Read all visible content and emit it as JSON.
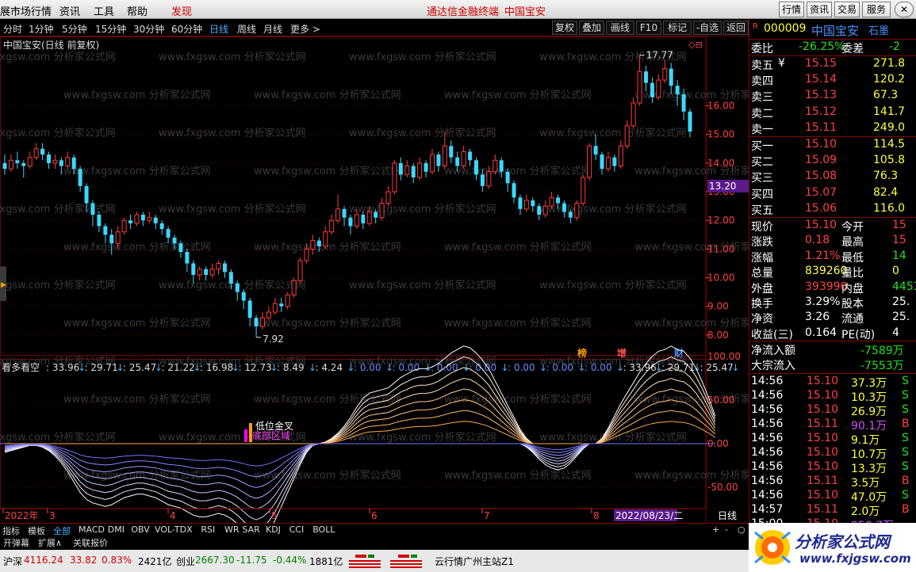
{
  "menubar": {
    "items": [
      "展市场行情",
      "资讯",
      "工具",
      "帮助"
    ],
    "discover": "发现",
    "title": "通达信金融终端",
    "stock_name": "中国宝安",
    "right_buttons": [
      "行情",
      "资讯",
      "交易",
      "服务"
    ]
  },
  "periods": {
    "items": [
      "分时",
      "1分钟",
      "5分钟",
      "15分钟",
      "30分钟",
      "60分钟",
      "日线",
      "周线",
      "月线",
      "更多 >"
    ],
    "active": "日线"
  },
  "tools": [
    "复权",
    "叠加",
    "画线",
    "F10",
    "标记",
    "-自选",
    "返回"
  ],
  "chart_title": "中国宝安(日线 前复权)",
  "price_axis": [
    {
      "v": 16.0,
      "t": "16.00"
    },
    {
      "v": 15.0,
      "t": "15.00"
    },
    {
      "v": 14.0,
      "t": "14.00"
    },
    {
      "v": 13.0,
      "t": "13.00"
    },
    {
      "v": 12.0,
      "t": "12.00"
    },
    {
      "v": 11.0,
      "t": "11.00"
    },
    {
      "v": 10.0,
      "t": "10.00"
    },
    {
      "v": 9.0,
      "t": "9.00"
    },
    {
      "v": 8.0,
      "t": "8.00"
    }
  ],
  "current_price_label": "13.20",
  "high_label": "17.77",
  "low_label": "7.92",
  "markers": [
    "榜",
    "增",
    "财"
  ],
  "indicator": {
    "name": "看多看空",
    "values": [
      "33.96",
      "29.71",
      "25.47",
      "21.22",
      "16.98",
      "12.73",
      "8.49",
      "4.24",
      "0.00",
      "0.00",
      "0.00",
      "0.00",
      "0.00",
      "0.00",
      "0.00",
      "33.96",
      "29.71",
      "25.47"
    ],
    "axis": [
      {
        "v": 100,
        "t": "100.00"
      },
      {
        "v": 50,
        "t": "50.00"
      },
      {
        "v": 0,
        "t": "0.00"
      },
      {
        "v": -50,
        "t": "-50.00"
      }
    ],
    "annotation1": "低位金叉",
    "annotation2": "底部区域"
  },
  "date_axis": {
    "labels": [
      "2022年",
      "3",
      "4",
      "5",
      "6",
      "7",
      "8"
    ],
    "cursor_date": "2022/08/23/二",
    "period": "日线"
  },
  "bottom_tabs": [
    "指标",
    "模板",
    "全部",
    "MACD",
    "DMI",
    "OBV",
    "VOL-TDX",
    "RSI",
    "WR",
    "SAR",
    "KDJ",
    "CCI",
    "BOLL"
  ],
  "bottom_active": "全部",
  "bottom_tabs2": [
    "开弹幕",
    "扩展∧",
    "关联报价"
  ],
  "status": {
    "sh_label": "沪深",
    "sh_index": "4116.24",
    "sh_chg": "33.82",
    "sh_pct": "0.83%",
    "sh_amt": "2421亿",
    "cy_label": "创业",
    "cy_index": "2667.30",
    "cy_chg": "-11.75",
    "cy_pct": "-0.44%",
    "cy_amt": "1881亿",
    "server": "云行情广州主站Z1"
  },
  "quote": {
    "code": "000009",
    "name": "中国宝安",
    "tag": "石墨",
    "prefix": "R",
    "weibi_label": "委比",
    "weibi": "-26.25%",
    "weicha_label": "委差",
    "weicha": "-2",
    "asks": [
      {
        "l": "卖五",
        "p": "15.15",
        "v": "271.8",
        "m": "¥"
      },
      {
        "l": "卖四",
        "p": "15.14",
        "v": "120.2"
      },
      {
        "l": "卖三",
        "p": "15.13",
        "v": "67.3"
      },
      {
        "l": "卖二",
        "p": "15.12",
        "v": "141.7"
      },
      {
        "l": "卖一",
        "p": "15.11",
        "v": "249.0"
      }
    ],
    "bids": [
      {
        "l": "买一",
        "p": "15.10",
        "v": "114.5"
      },
      {
        "l": "买二",
        "p": "15.09",
        "v": "105.8"
      },
      {
        "l": "买三",
        "p": "15.08",
        "v": "76.3"
      },
      {
        "l": "买四",
        "p": "15.07",
        "v": "82.4"
      },
      {
        "l": "买五",
        "p": "15.06",
        "v": "116.0"
      }
    ],
    "stats": [
      {
        "l1": "现价",
        "v1": "15.10",
        "c1": "red",
        "l2": "今开",
        "v2": "15",
        "c2": "red"
      },
      {
        "l1": "涨跌",
        "v1": "0.18",
        "c1": "red",
        "l2": "最高",
        "v2": "15",
        "c2": "red"
      },
      {
        "l1": "涨幅",
        "v1": "1.21%",
        "c1": "red",
        "l2": "最低",
        "v2": "14",
        "c2": "grn"
      },
      {
        "l1": "总量",
        "v1": "839260",
        "c1": "yel",
        "l2": "量比",
        "v2": "0",
        "c2": "yel"
      },
      {
        "l1": "外盘",
        "v1": "393990",
        "c1": "red",
        "l2": "内盘",
        "v2": "4453",
        "c2": "grn"
      },
      {
        "l1": "换手",
        "v1": "3.29%",
        "c1": "wht",
        "l2": "股本",
        "v2": "25.",
        "c2": "wht"
      },
      {
        "l1": "净资",
        "v1": "3.26",
        "c1": "wht",
        "l2": "流通",
        "v2": "25.",
        "c2": "wht"
      },
      {
        "l1": "收益(三)",
        "v1": "0.164",
        "c1": "wht",
        "l2": "PE(动)",
        "v2": "4",
        "c2": "wht"
      }
    ],
    "flows": [
      {
        "l": "净流入额",
        "v": "-7589万"
      },
      {
        "l": "大宗流入",
        "v": "-7553万"
      }
    ],
    "ticks": [
      {
        "t": "14:56",
        "p": "15.10",
        "v": "37.3万",
        "s": "S"
      },
      {
        "t": "14:56",
        "p": "15.10",
        "v": "10.3万",
        "s": "S"
      },
      {
        "t": "14:56",
        "p": "15.10",
        "v": "26.9万",
        "s": "S"
      },
      {
        "t": "14:56",
        "p": "15.11",
        "v": "90.1万",
        "s": "B"
      },
      {
        "t": "14:56",
        "p": "15.10",
        "v": "9.1万",
        "s": "S"
      },
      {
        "t": "14:56",
        "p": "15.10",
        "v": "10.7万",
        "s": "S"
      },
      {
        "t": "14:56",
        "p": "15.10",
        "v": "13.3万",
        "s": "S"
      },
      {
        "t": "14:56",
        "p": "15.11",
        "v": "3.5万",
        "s": "B"
      },
      {
        "t": "14:56",
        "p": "15.10",
        "v": "47.0万",
        "s": "S"
      },
      {
        "t": "14:57",
        "p": "15.11",
        "v": "2.0万",
        "s": "B"
      },
      {
        "t": "15:00",
        "p": "15.10",
        "v": "950.7万",
        "s": ""
      }
    ]
  },
  "watermark": "www.fxgsw.com 分析家公式网",
  "logo": {
    "name": "分析家公式网",
    "url": "www.fxjgsw.com"
  },
  "colors": {
    "up": "#ff3c3c",
    "down": "#3cd8ff",
    "bg": "#000000",
    "grid": "#700000"
  },
  "chart_data": {
    "type": "candlestick",
    "ylim": [
      7.5,
      18.2
    ],
    "candles": [
      [
        14.0,
        13.8,
        14.3,
        13.6
      ],
      [
        13.8,
        14.1,
        14.3,
        13.7
      ],
      [
        14.1,
        14.0,
        14.4,
        13.8
      ],
      [
        14.0,
        13.9,
        14.1,
        13.5
      ],
      [
        13.9,
        14.2,
        14.4,
        13.8
      ],
      [
        14.2,
        14.5,
        14.7,
        14.1
      ],
      [
        14.5,
        14.3,
        14.7,
        14.1
      ],
      [
        14.3,
        14.0,
        14.4,
        13.8
      ],
      [
        14.0,
        14.1,
        14.3,
        13.8
      ],
      [
        14.1,
        13.9,
        14.2,
        13.6
      ],
      [
        13.9,
        14.2,
        14.4,
        13.8
      ],
      [
        14.2,
        13.8,
        14.3,
        13.6
      ],
      [
        13.8,
        13.2,
        13.9,
        13.0
      ],
      [
        13.2,
        12.6,
        13.3,
        12.3
      ],
      [
        12.6,
        12.2,
        12.7,
        11.8
      ],
      [
        12.2,
        11.8,
        12.3,
        11.6
      ],
      [
        11.8,
        11.5,
        11.9,
        11.2
      ],
      [
        11.5,
        11.2,
        11.7,
        10.8
      ],
      [
        11.2,
        11.6,
        11.8,
        11.0
      ],
      [
        11.6,
        12.0,
        12.1,
        11.5
      ],
      [
        12.0,
        11.9,
        12.2,
        11.7
      ],
      [
        11.9,
        12.2,
        12.3,
        11.8
      ],
      [
        12.2,
        12.0,
        12.3,
        11.8
      ],
      [
        12.0,
        12.1,
        12.3,
        11.9
      ],
      [
        12.1,
        11.9,
        12.2,
        11.7
      ],
      [
        11.9,
        11.7,
        12.0,
        11.5
      ],
      [
        11.7,
        11.4,
        11.8,
        11.2
      ],
      [
        11.4,
        11.2,
        11.5,
        11.0
      ],
      [
        11.2,
        10.9,
        11.3,
        10.7
      ],
      [
        10.9,
        10.5,
        11.0,
        10.2
      ],
      [
        10.5,
        10.1,
        10.6,
        9.8
      ],
      [
        10.1,
        10.3,
        10.4,
        9.9
      ],
      [
        10.3,
        10.1,
        10.4,
        9.9
      ],
      [
        10.1,
        10.3,
        10.5,
        10.0
      ],
      [
        10.3,
        10.5,
        10.6,
        10.1
      ],
      [
        10.5,
        10.2,
        10.6,
        10.0
      ],
      [
        10.2,
        9.8,
        10.3,
        9.6
      ],
      [
        9.8,
        9.5,
        9.9,
        9.2
      ],
      [
        9.5,
        9.2,
        9.6,
        8.9
      ],
      [
        9.2,
        8.6,
        9.3,
        8.3
      ],
      [
        8.6,
        8.3,
        8.7,
        7.92
      ],
      [
        8.3,
        8.6,
        8.8,
        8.2
      ],
      [
        8.6,
        8.8,
        9.0,
        8.5
      ],
      [
        8.8,
        9.1,
        9.3,
        8.7
      ],
      [
        9.1,
        9.0,
        9.3,
        8.8
      ],
      [
        9.0,
        9.4,
        9.5,
        8.9
      ],
      [
        9.4,
        9.9,
        10.0,
        9.3
      ],
      [
        9.9,
        10.6,
        10.7,
        9.8
      ],
      [
        10.6,
        11.0,
        11.2,
        10.5
      ],
      [
        11.0,
        11.3,
        11.5,
        10.8
      ],
      [
        11.3,
        11.1,
        11.4,
        10.9
      ],
      [
        11.1,
        11.6,
        11.8,
        11.0
      ],
      [
        11.6,
        12.0,
        12.2,
        11.5
      ],
      [
        12.0,
        12.4,
        12.9,
        11.9
      ],
      [
        12.4,
        12.1,
        12.5,
        11.8
      ],
      [
        12.1,
        11.8,
        12.2,
        11.5
      ],
      [
        11.8,
        12.2,
        12.4,
        11.7
      ],
      [
        12.2,
        11.9,
        12.3,
        11.7
      ],
      [
        11.9,
        12.3,
        12.5,
        11.8
      ],
      [
        12.3,
        12.1,
        12.4,
        11.9
      ],
      [
        12.1,
        12.6,
        12.8,
        12.0
      ],
      [
        12.6,
        13.0,
        13.2,
        12.5
      ],
      [
        13.0,
        14.0,
        14.1,
        12.9
      ],
      [
        14.0,
        13.6,
        14.2,
        13.4
      ],
      [
        13.6,
        13.9,
        14.1,
        13.5
      ],
      [
        13.9,
        13.5,
        14.0,
        13.3
      ],
      [
        13.5,
        14.0,
        14.2,
        13.4
      ],
      [
        14.0,
        13.7,
        14.1,
        13.5
      ],
      [
        13.7,
        14.3,
        14.5,
        13.6
      ],
      [
        14.3,
        13.9,
        14.4,
        13.7
      ],
      [
        13.9,
        14.6,
        15.1,
        13.8
      ],
      [
        14.6,
        14.2,
        14.8,
        14.0
      ],
      [
        14.2,
        13.9,
        14.4,
        13.7
      ],
      [
        13.9,
        14.4,
        14.6,
        13.8
      ],
      [
        14.4,
        14.1,
        14.5,
        13.9
      ],
      [
        14.1,
        13.6,
        14.2,
        13.4
      ],
      [
        13.6,
        13.2,
        13.8,
        13.0
      ],
      [
        13.2,
        13.7,
        13.9,
        13.1
      ],
      [
        13.7,
        14.1,
        14.3,
        13.6
      ],
      [
        14.1,
        13.7,
        14.2,
        13.5
      ],
      [
        13.7,
        13.3,
        13.8,
        13.0
      ],
      [
        13.3,
        12.8,
        13.4,
        12.6
      ],
      [
        12.8,
        12.4,
        12.9,
        12.2
      ],
      [
        12.4,
        12.7,
        12.9,
        12.3
      ],
      [
        12.7,
        12.5,
        12.8,
        12.3
      ],
      [
        12.5,
        12.2,
        12.6,
        12.0
      ],
      [
        12.2,
        12.5,
        12.7,
        12.1
      ],
      [
        12.5,
        12.8,
        13.0,
        12.4
      ],
      [
        12.8,
        12.6,
        12.9,
        12.4
      ],
      [
        12.6,
        12.3,
        12.7,
        12.1
      ],
      [
        12.3,
        12.1,
        12.4,
        11.9
      ],
      [
        12.1,
        12.6,
        12.7,
        12.0
      ],
      [
        12.6,
        13.5,
        13.6,
        12.5
      ],
      [
        13.5,
        14.6,
        14.7,
        13.4
      ],
      [
        14.6,
        14.3,
        15.0,
        14.1
      ],
      [
        14.3,
        13.8,
        14.4,
        13.6
      ],
      [
        13.8,
        14.2,
        14.4,
        13.7
      ],
      [
        14.2,
        13.9,
        14.3,
        13.7
      ],
      [
        13.9,
        14.6,
        14.8,
        13.8
      ],
      [
        14.6,
        15.3,
        15.5,
        14.5
      ],
      [
        15.3,
        16.1,
        16.3,
        15.2
      ],
      [
        16.1,
        17.2,
        17.77,
        16.0
      ],
      [
        17.2,
        16.8,
        17.4,
        16.5
      ],
      [
        16.8,
        16.3,
        17.0,
        16.1
      ],
      [
        16.3,
        16.9,
        17.1,
        16.2
      ],
      [
        16.9,
        17.3,
        17.6,
        16.8
      ],
      [
        17.3,
        16.7,
        17.5,
        16.4
      ],
      [
        16.7,
        16.4,
        16.9,
        16.0
      ],
      [
        16.4,
        15.8,
        16.6,
        15.5
      ],
      [
        15.8,
        15.1,
        15.9,
        14.9
      ]
    ],
    "indicator_upper": [
      0,
      0,
      0,
      0,
      0,
      0,
      0,
      0,
      0,
      0,
      0,
      0,
      0,
      0,
      0,
      0,
      0,
      0,
      0,
      0,
      0,
      0,
      0,
      0,
      0,
      0,
      0,
      0,
      0,
      0,
      0,
      0,
      0,
      0,
      0,
      0,
      0,
      0,
      0,
      0,
      0,
      0,
      0,
      0,
      0,
      0,
      0,
      0,
      0,
      0,
      0,
      2,
      6,
      12,
      20,
      30,
      42,
      52,
      58,
      60,
      62,
      64,
      70,
      76,
      80,
      84,
      86,
      86,
      88,
      92,
      98,
      104,
      108,
      112,
      110,
      104,
      96,
      86,
      72,
      58,
      44,
      30,
      16,
      6,
      0,
      0,
      0,
      0,
      0,
      0,
      0,
      0,
      0,
      0,
      0,
      6,
      18,
      32,
      46,
      58,
      70,
      82,
      92,
      100,
      106,
      108,
      112,
      108,
      106,
      98,
      86,
      70,
      52,
      32
    ],
    "indicator_lower": [
      -10,
      -8,
      -6,
      -4,
      -2,
      -2,
      -4,
      -8,
      -14,
      -22,
      -32,
      -44,
      -56,
      -64,
      -68,
      -70,
      -72,
      -70,
      -66,
      -62,
      -60,
      -58,
      -58,
      -60,
      -62,
      -66,
      -70,
      -72,
      -74,
      -78,
      -82,
      -84,
      -84,
      -82,
      -80,
      -82,
      -86,
      -92,
      -100,
      -108,
      -112,
      -108,
      -100,
      -88,
      -72,
      -56,
      -40,
      -24,
      -10,
      -2,
      0,
      0,
      0,
      0,
      0,
      0,
      0,
      0,
      0,
      0,
      0,
      0,
      0,
      0,
      0,
      0,
      0,
      0,
      0,
      0,
      0,
      0,
      0,
      0,
      0,
      0,
      0,
      0,
      0,
      0,
      0,
      0,
      0,
      -4,
      -10,
      -18,
      -24,
      -28,
      -30,
      -28,
      -22,
      -14,
      -6,
      0,
      0,
      0,
      0,
      0,
      0,
      0,
      0,
      0,
      0,
      0,
      0,
      0,
      0,
      0,
      0,
      0,
      0,
      0,
      0,
      0
    ]
  }
}
